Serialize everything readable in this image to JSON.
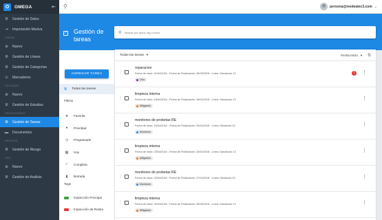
{
  "app": {
    "name": "OMEGA",
    "logo_letter": "O"
  },
  "sidebar": {
    "groups": [
      {
        "items": [
          {
            "label": "Gestión de Datos",
            "icon": "list-icon",
            "glyph": "≣"
          },
          {
            "label": "Importación Masiva",
            "icon": "import-icon",
            "glyph": "⇥"
          }
        ]
      },
      {
        "title": "LÍNEAS",
        "items": [
          {
            "label": "Nuevo",
            "icon": "add-circle-icon",
            "glyph": "⊕"
          },
          {
            "label": "Gestión de Líneas",
            "icon": "list-icon",
            "glyph": "≣"
          },
          {
            "label": "Gestión de Categorías",
            "icon": "list-icon",
            "glyph": "≣"
          },
          {
            "label": "Marcadores",
            "icon": "bookmark-icon",
            "glyph": "⊙"
          }
        ]
      },
      {
        "title": "ESTUDIOS",
        "items": [
          {
            "label": "Nuevo",
            "icon": "add-circle-icon",
            "glyph": "⊕"
          },
          {
            "label": "Gestión de Estudios",
            "icon": "list-icon",
            "glyph": "≣"
          }
        ]
      },
      {
        "title": "APLICACIONES",
        "items": [
          {
            "label": "Gestión de Tareas",
            "icon": "list-icon",
            "glyph": "≣",
            "active": true
          },
          {
            "label": "Documentos",
            "icon": "folder-icon",
            "glyph": "▬"
          }
        ]
      },
      {
        "title": "RIESGOS",
        "items": [
          {
            "label": "Gestión de Riesgo",
            "icon": "list-icon",
            "glyph": "≣"
          }
        ]
      },
      {
        "title": "OPA",
        "items": [
          {
            "label": "Nuevo",
            "icon": "add-circle-icon",
            "glyph": "⊕"
          },
          {
            "label": "Gestión de Análisis",
            "icon": "list-icon",
            "glyph": "≣"
          }
        ]
      }
    ]
  },
  "user": {
    "email": "persona@medeatec3.com"
  },
  "header": {
    "title_line1": "Gestión de",
    "title_line2": "tareas"
  },
  "search": {
    "placeholder": "Buscar por tarea, tag o línea"
  },
  "actions": {
    "new_task": "AGREGAR TAREA",
    "all_tasks": "Todas las tareas"
  },
  "filters": {
    "title": "Filtros",
    "items": [
      {
        "label": "Favorita",
        "icon": "star-icon",
        "glyph": "★"
      },
      {
        "label": "Prioridad",
        "icon": "priority-icon",
        "glyph": "●"
      },
      {
        "label": "Programado",
        "icon": "clock-icon",
        "glyph": "◷"
      },
      {
        "label": "Hoy",
        "icon": "calendar-icon",
        "glyph": "▦"
      },
      {
        "label": "Completa",
        "icon": "check-icon",
        "glyph": "✓"
      },
      {
        "label": "Borrada",
        "icon": "trash-icon",
        "glyph": "▮"
      }
    ]
  },
  "tags": {
    "title": "Tags",
    "items": [
      {
        "label": "Inspección Principal",
        "color": "#43a047"
      },
      {
        "label": "Inspección de Rutina",
        "color": "#e53935"
      }
    ]
  },
  "list": {
    "filter_label": "Todas las tareas",
    "sort_label": "Fecha Inicio"
  },
  "tasks": [
    {
      "title": "reparacion",
      "meta": "Fecha de inicio: 01/04/2018 - Fecha de Finalización: 30/09/2018 - Línea: Gasoducto 12",
      "tag": "Otro",
      "tag_color": "#8e24aa",
      "alert": "!"
    },
    {
      "title": "limpieza interna",
      "meta": "Fecha de inicio: 16/04/2018 - Fecha de Finalización: 16/04/2018 - Línea: Gasoducto 12",
      "tag": "Mitigación",
      "tag_color": "#f57c00"
    },
    {
      "title": "monitores de probetas RE",
      "meta": "Fecha de inicio: 16/04/2018 - Fecha de Finalización: 20/04/2018 - Línea: Oleoducto 10",
      "tag": "Monitoreo",
      "tag_color": "#1e88e5"
    },
    {
      "title": "limpieza interna",
      "meta": "Fecha de inicio: 23/04/2018 - Fecha de Finalización: 23/04/2018 - Línea: Gasoducto 12",
      "tag": "Mitigación",
      "tag_color": "#f57c00"
    },
    {
      "title": "monitores de probetas RE",
      "meta": "Fecha de inicio: 23/04/2018 - Fecha de Finalización: 27/04/2018 - Línea: Oleoducto 10",
      "tag": "Monitoreo",
      "tag_color": "#1e88e5"
    },
    {
      "title": "limpieza interna",
      "meta": "Fecha de inicio: 30/04/2018 - Fecha de Finalización: 30/05/2018 - Línea: Gasoducto 12",
      "tag": "Mitigación",
      "tag_color": "#f57c00"
    }
  ]
}
